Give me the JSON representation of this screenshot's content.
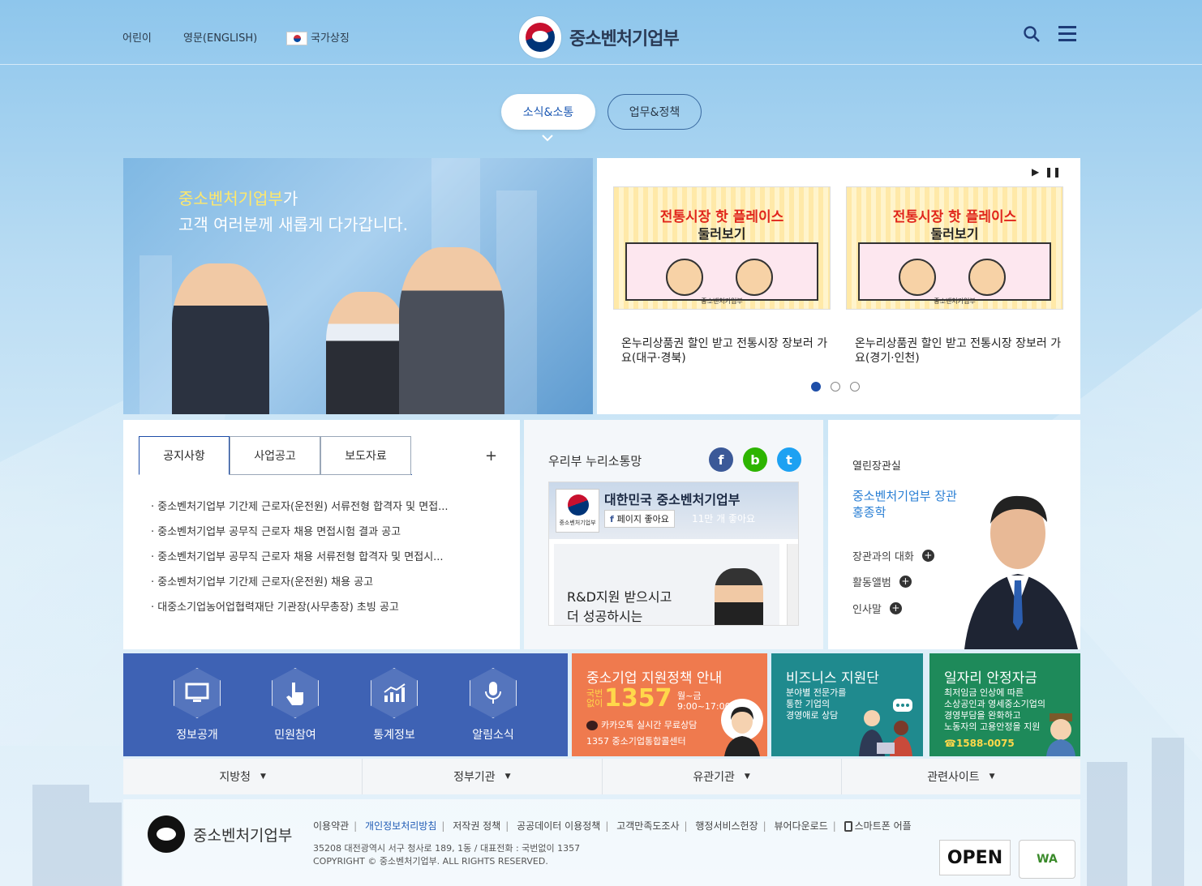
{
  "header": {
    "links": [
      "어린이",
      "영문(ENGLISH)",
      "국가상징"
    ],
    "logo_text": "중소벤처기업부"
  },
  "main_tabs": [
    "소식&소통",
    "업무&정책"
  ],
  "banner": {
    "line1_highlight": "중소벤처기업부",
    "line1_rest": "가",
    "line2": "고객 여러분께 새롭게 다가갑니다."
  },
  "slider": {
    "cards": [
      {
        "title": "전통시장 핫 플레이스",
        "subtitle": "둘러보기",
        "caption": "온누리상품권 할인 받고 전통시장 장보러 가요(대구·경북)"
      },
      {
        "title": "전통시장 핫 플레이스",
        "subtitle": "둘러보기",
        "caption": "온누리상품권 할인 받고 전통시장 장보러 가요(경기·인천)"
      }
    ],
    "logo_label": "중소벤처기업부",
    "page_count": 3,
    "active_page": 1
  },
  "notices": {
    "tabs": [
      "공지사항",
      "사업공고",
      "보도자료"
    ],
    "more": "+",
    "items": [
      "중소벤처기업부 기간제 근로자(운전원) 서류전형 합격자 및 면접...",
      "중소벤처기업부 공무직 근로자 채용 면접시험 결과 공고",
      "중소벤처기업부 공무직 근로자 채용 서류전형 합격자 및 면접시...",
      "중소벤처기업부 기간제 근로자(운전원) 채용 공고",
      "대중소기업농어업협력재단 기관장(사무총장) 초빙 공고"
    ]
  },
  "social": {
    "title": "우리부 누리소통망",
    "buttons": [
      "f",
      "b",
      "t"
    ],
    "fb_page_name": "대한민국 중소벤처기업부",
    "fb_logo_label": "중소벤처기업부",
    "fb_like": "페이지 좋아요",
    "fb_count": "11만 개 좋아요",
    "post_line1": "R&D지원 받으시고",
    "post_line2": "더 성공하시는"
  },
  "minister": {
    "title": "열린장관실",
    "name_line1": "중소벤처기업부 장관",
    "name_line2": "홍종학",
    "links": [
      "장관과의 대화",
      "활동앨범",
      "인사말"
    ]
  },
  "quick_menu": [
    "정보공개",
    "민원참여",
    "통계정보",
    "알림소식"
  ],
  "promos": {
    "policy": {
      "title": "중소기업 지원정책 안내",
      "free_label": "국번없이",
      "number": "1357",
      "hours_days": "월~금",
      "hours_time": "9:00~17:00",
      "kakao": "카카오톡 실시간 무료상담",
      "center": "1357 중소기업통합콜센터"
    },
    "business": {
      "title": "비즈니스 지원단",
      "sub": [
        "분야별 전문가를",
        "통한 기업의",
        "경영애로 상담"
      ]
    },
    "job": {
      "title": "일자리 안정자금",
      "sub": [
        "최저임금 인상에 따른",
        "소상공인과 영세중소기업의",
        "경영부담을 완화하고",
        "노동자의 고용안정을 지원"
      ],
      "phone": "☎1588-0075"
    }
  },
  "related": [
    "지방청",
    "정부기관",
    "유관기관",
    "관련사이트"
  ],
  "footer": {
    "logo_text": "중소벤처기업부",
    "links": [
      "이용약관",
      "개인정보처리방침",
      "저작권 정책",
      "공공데이터 이용정책",
      "고객만족도조사",
      "행정서비스헌장",
      "뷰어다운로드",
      "스마트폰 어플"
    ],
    "address": "35208 대전광역시 서구 청사로 189, 1동 / 대표전화 : 국번없이 1357",
    "copyright": "COPYRIGHT © 중소벤처기업부. ALL RIGHTS RESERVED.",
    "open_badge": "OPEN",
    "wa_badge": "WA"
  },
  "colors": {
    "primary_blue": "#1e4ea8",
    "quick_bg": "#3e62b4",
    "policy_bg": "#ef7a4e",
    "business_bg": "#1f8a8e",
    "job_bg": "#1e8a5a"
  }
}
